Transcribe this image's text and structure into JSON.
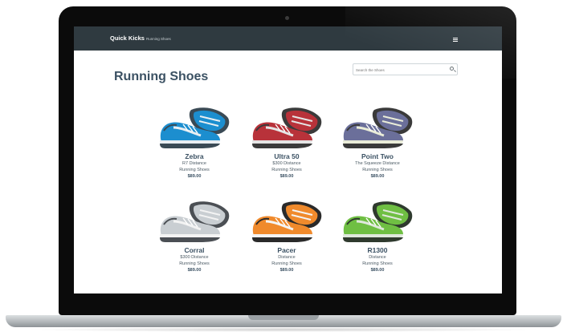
{
  "navbar": {
    "brand": "Quick Kicks",
    "brand_sub": "Running Shoes",
    "menu_icon": "hamburger-icon"
  },
  "page": {
    "title": "Running Shoes"
  },
  "search": {
    "placeholder": "Search the Shoes",
    "icon": "search-icon"
  },
  "products": [
    {
      "name": "Zebra",
      "line1": "R7 Distance",
      "line2": "Running Shoes",
      "price": "$89.00",
      "colors": [
        "#1c8ecf",
        "#e8eef2",
        "#3a4a55"
      ]
    },
    {
      "name": "Ultra 50",
      "line1": "$300 Distance",
      "line2": "Running Shoes",
      "price": "$89.00",
      "colors": [
        "#b8323a",
        "#e5e5e5",
        "#3b3b3b"
      ]
    },
    {
      "name": "Point Two",
      "line1": "The Squeeze Distance",
      "line2": "Running Shoes",
      "price": "$89.00",
      "colors": [
        "#6b6f9a",
        "#e9ecd8",
        "#3a3a3a"
      ]
    },
    {
      "name": "Corral",
      "line1": "$300 Distance",
      "line2": "Running Shoes",
      "price": "$89.00",
      "colors": [
        "#c9ced2",
        "#f3f3f3",
        "#4b4f54"
      ]
    },
    {
      "name": "Pacer",
      "line1": "Distance",
      "line2": "Running Shoes",
      "price": "$89.00",
      "colors": [
        "#f08a2c",
        "#f4f4f4",
        "#2a2a2a"
      ]
    },
    {
      "name": "R1300",
      "line1": "Distance",
      "line2": "Running Shoes",
      "price": "$89.00",
      "colors": [
        "#6fbf43",
        "#dfe8dc",
        "#2f3a2e"
      ]
    }
  ]
}
